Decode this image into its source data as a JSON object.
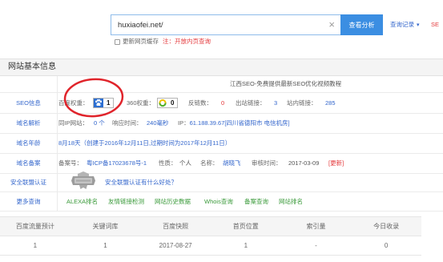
{
  "search": {
    "value": "huxiaofei.net/",
    "clear_symbol": "×",
    "submit_label": "查看分析",
    "history_label": "查询记录",
    "history_caret": "▾",
    "extra_link": "SE"
  },
  "cache": {
    "checkbox_label": "更新网页缓存",
    "note": "注：开放内页查询",
    "checked": false
  },
  "info": {
    "title": "网站基本信息",
    "site_title": "江西SEO-免费提供最新SEO优化视频教程",
    "seo": {
      "label": "SEO信息",
      "baidu_rank_label": "百度权重：",
      "baidu_rank": "1",
      "so360_rank_label": "360权重：",
      "so360_rank": "0",
      "backlinks_label": "反链数：",
      "backlinks": "0",
      "outbound_label": "出站链接：",
      "outbound": "3",
      "internal_label": "站内链接：",
      "internal": "285"
    },
    "dns": {
      "label": "域名解析",
      "same_ip_label": "同IP网站：",
      "same_ip": "0 个",
      "response_label": "响应时间：",
      "response": "240毫秒",
      "ip_label": "IP：",
      "ip": "61.188.39.67[四川省德阳市 电信机房]"
    },
    "age": {
      "label": "域名年龄",
      "value": "8月18天（创建于2016年12月11日,过期时间为2017年12月11日）"
    },
    "icp": {
      "label": "域名备案",
      "number_label": "备案号：",
      "number": "粤ICP备17023678号-1",
      "type_label": "性质：",
      "type": "个人",
      "name_label": "名称：",
      "name": "胡晓飞",
      "review_label": "审核时间：",
      "review_date": "2017-03-09",
      "update_link": "[更新]"
    },
    "security": {
      "label": "安全联盟认证",
      "help_link": "安全联盟认证有什么好处？"
    },
    "more": {
      "label": "更多查询",
      "links": [
        "ALEXA排名",
        "友情链接检测",
        "网站历史数据",
        "Whois查询",
        "备案查询",
        "网站排名"
      ]
    }
  },
  "stats": {
    "headers": [
      "百度流量预计",
      "关键词库",
      "百度快照",
      "首页位置",
      "索引量",
      "今日收录"
    ],
    "values": [
      "1",
      "1",
      "2017-08-27",
      "1",
      "-",
      "0"
    ]
  },
  "icons": {
    "clear": "close-icon",
    "history": "chevron-down-icon",
    "baidu": "baidu-paw-icon",
    "so360": "360-logo-icon",
    "security": "security-badge-icon"
  },
  "colors": {
    "accent": "#3b8ee2",
    "link": "#3366cc",
    "more_link": "#3a9a3a",
    "alert": "#e4393c",
    "annotation": "#e0242b",
    "header_bg": "#f4f4f4"
  }
}
